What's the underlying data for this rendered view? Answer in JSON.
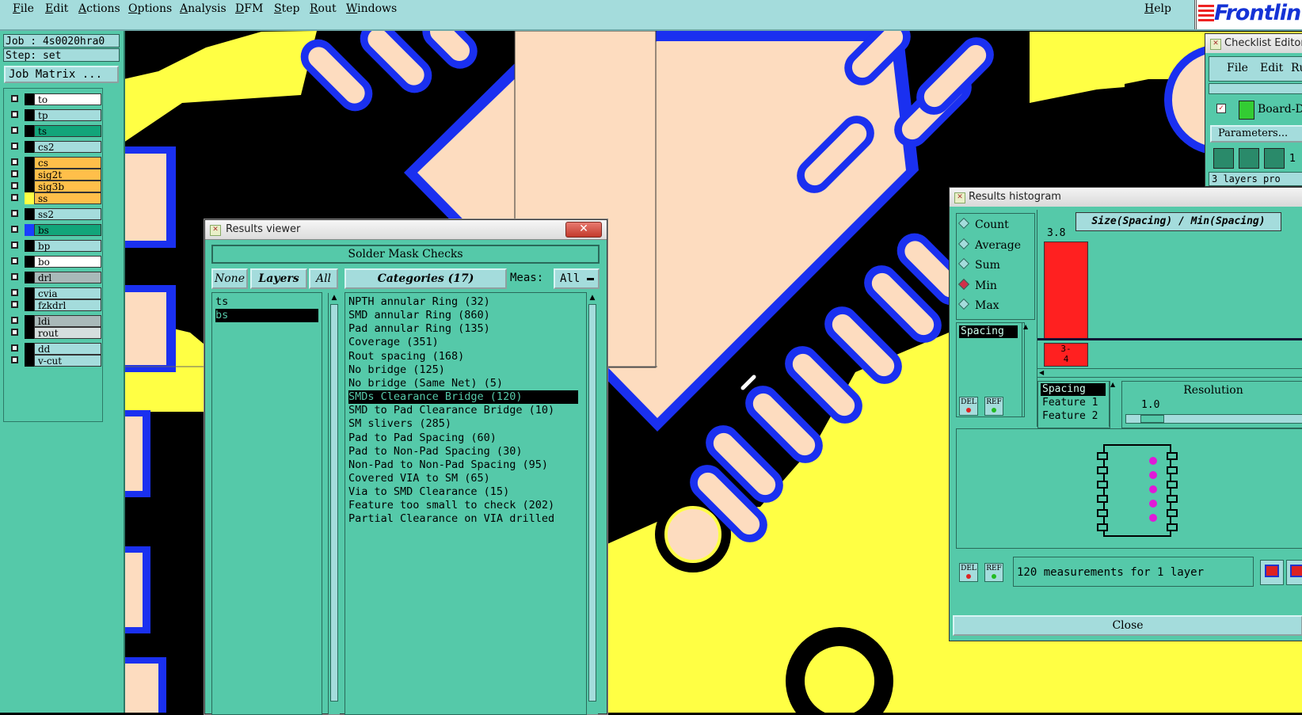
{
  "menubar": {
    "items": [
      "File",
      "Edit",
      "Actions",
      "Options",
      "Analysis",
      "DFM",
      "Step",
      "Rout",
      "Windows"
    ],
    "help": "Help",
    "logo": "Frontlin"
  },
  "left_panel": {
    "job": "Job : 4s0020hra0",
    "step": "Step: set",
    "job_matrix": "Job Matrix ...",
    "layers": [
      {
        "name": "to",
        "color": "#ffffff",
        "swatch": "#000000"
      },
      {
        "name": "tp",
        "color": "#a4dcdc",
        "swatch": "#000000"
      },
      {
        "name": "ts",
        "color": "#12a57a",
        "swatch": "#000000"
      },
      {
        "name": "cs2",
        "color": "#a4dcdc",
        "swatch": "#000000"
      },
      {
        "name": "cs",
        "color": "#ffbf4a",
        "swatch": "#000000"
      },
      {
        "name": "sig2t",
        "color": "#ffbf4a",
        "swatch": "#000000"
      },
      {
        "name": "sig3b",
        "color": "#ffbf4a",
        "swatch": "#000000"
      },
      {
        "name": "ss",
        "color": "#ffbf4a",
        "swatch": "#ffff44"
      },
      {
        "name": "ss2",
        "color": "#a4dcdc",
        "swatch": "#000000"
      },
      {
        "name": "bs",
        "color": "#12a57a",
        "swatch": "#1a3dff"
      },
      {
        "name": "bp",
        "color": "#a4dcdc",
        "swatch": "#000000"
      },
      {
        "name": "bo",
        "color": "#ffffff",
        "swatch": "#000000"
      },
      {
        "name": "drl",
        "color": "#a9b9b9",
        "swatch": "#000000"
      },
      {
        "name": "cvia",
        "color": "#a4dcdc",
        "swatch": "#000000"
      },
      {
        "name": "fzkdrl",
        "color": "#a4dcdc",
        "swatch": "#000000"
      },
      {
        "name": "ldi",
        "color": "#a9b9b9",
        "swatch": "#000000"
      },
      {
        "name": "rout",
        "color": "#d6dede",
        "swatch": "#000000"
      },
      {
        "name": "dd",
        "color": "#a4dcdc",
        "swatch": "#000000"
      },
      {
        "name": "v-cut",
        "color": "#a4dcdc",
        "swatch": "#000000"
      }
    ]
  },
  "results_viewer": {
    "title": "Results viewer",
    "header": "Solder Mask Checks",
    "none_btn": "None",
    "layers_btn": "Layers",
    "all_btn": "All",
    "categories_btn": "Categories (17)",
    "meas_label": "Meas:",
    "meas_value": "All",
    "layer_rows": [
      "ts",
      "bs"
    ],
    "selected_layer": "bs",
    "categories": [
      "NPTH annular Ring (32)",
      "SMD annular Ring (860)",
      "Pad annular Ring (135)",
      "Coverage (351)",
      "Rout spacing (168)",
      "No bridge (125)",
      "No bridge (Same Net) (5)",
      "SMDs Clearance Bridge (120)",
      "SMD to Pad Clearance Bridge (10)",
      "SM slivers (285)",
      "Pad to Pad Spacing (60)",
      "Pad to Non-Pad Spacing (30)",
      "Non-Pad to Non-Pad Spacing (95)",
      "Covered VIA to SM (65)",
      "Via to SMD Clearance (15)",
      "Feature too small to check (202)",
      "Partial Clearance on VIA drilled"
    ],
    "selected_category": "SMDs Clearance Bridge (120)"
  },
  "histogram": {
    "title": "Results histogram",
    "radios": [
      "Count",
      "Average",
      "Sum",
      "Min",
      "Max"
    ],
    "selected_radio": "Min",
    "chart_title": "Size(Spacing) / Min(Spacing)",
    "bar_value_label": "3.8",
    "bin_label": "3-\n4",
    "bin_label_top": "3-",
    "bin_label_bottom": "4",
    "bar_color": "#ff2020",
    "sel_list": [
      "Spacing"
    ],
    "res_list": [
      "Spacing",
      "Feature 1",
      "Feature 2"
    ],
    "resolution_label": "Resolution",
    "resolution_value": "1.0",
    "del_btn": "DEL",
    "ref_btn": "REF",
    "status": "120 measurements for 1 layer",
    "close_btn": "Close"
  },
  "checklist_editor": {
    "title": "Checklist Editor",
    "menu": [
      "File",
      "Edit",
      "Ru"
    ],
    "item": "Board-D",
    "parameters_btn": "Parameters...",
    "count": "1",
    "note": "3 layers pro"
  },
  "colors": {
    "panel": "#55c9a9",
    "light_panel": "#a4dcdc",
    "copper_yellow": "#ffff44",
    "mask_blue": "#1a30f0",
    "pad_peach": "#fddcbf"
  }
}
